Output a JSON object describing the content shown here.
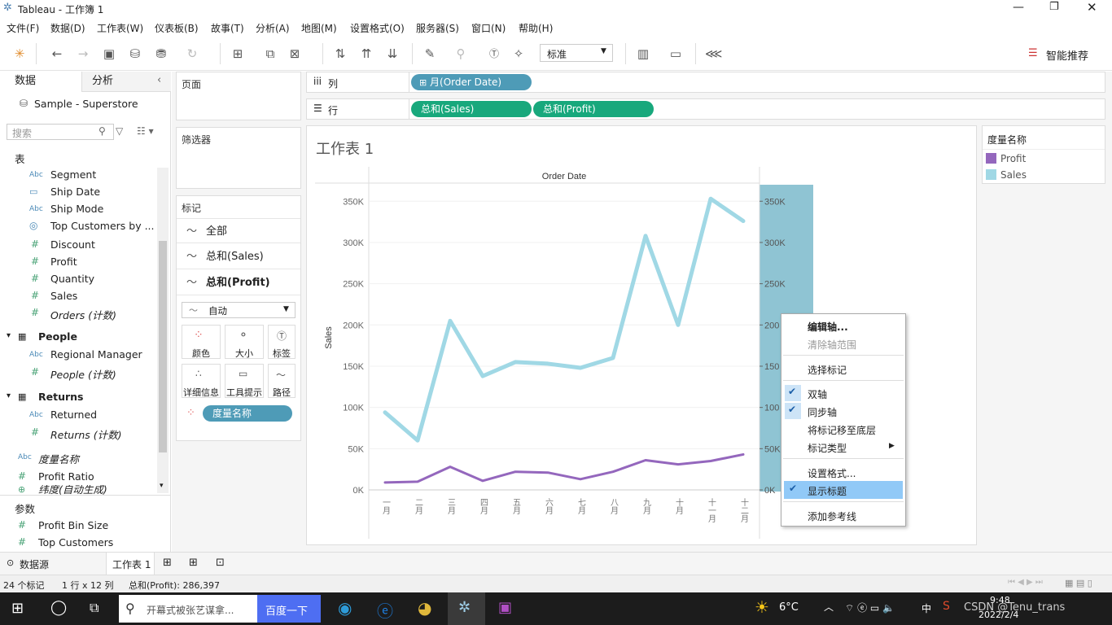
{
  "window": {
    "title": "Tableau - 工作簿 1"
  },
  "menu": [
    "文件(F)",
    "数据(D)",
    "工作表(W)",
    "仪表板(B)",
    "故事(T)",
    "分析(A)",
    "地图(M)",
    "设置格式(O)",
    "服务器(S)",
    "窗口(N)",
    "帮助(H)"
  ],
  "toolbar": {
    "fit_value": "标准",
    "recommend_label": "智能推荐"
  },
  "left": {
    "tab_data": "数据",
    "tab_analysis": "分析",
    "datasource": "Sample - Superstore",
    "search_placeholder": "搜索",
    "section_table": "表",
    "orders_fields": [
      {
        "type": "Abc",
        "name": "Segment"
      },
      {
        "type": "date",
        "name": "Ship Date"
      },
      {
        "type": "Abc",
        "name": "Ship Mode"
      },
      {
        "type": "set",
        "name": "Top Customers by ..."
      },
      {
        "type": "#",
        "name": "Discount"
      },
      {
        "type": "#",
        "name": "Profit"
      },
      {
        "type": "#",
        "name": "Quantity"
      },
      {
        "type": "#",
        "name": "Sales"
      },
      {
        "type": "#",
        "name": "Orders (计数)"
      }
    ],
    "people_title": "People",
    "people_fields": [
      {
        "type": "Abc",
        "name": "Regional Manager"
      },
      {
        "type": "#",
        "name": "People (计数)"
      }
    ],
    "returns_title": "Returns",
    "returns_fields": [
      {
        "type": "Abc",
        "name": "Returned"
      },
      {
        "type": "#",
        "name": "Returns (计数)"
      }
    ],
    "measure_names": "度量名称",
    "profit_ratio": "Profit Ratio",
    "latitude": "纬度(自动生成)",
    "section_params": "参数",
    "params": [
      "Profit Bin Size",
      "Top Customers"
    ]
  },
  "shelves": {
    "pages_label": "页面",
    "filters_label": "筛选器",
    "marks_label": "标记",
    "columns_label": "列",
    "rows_label": "行",
    "columns_pill": "月(Order Date)",
    "rows_pills": [
      "总和(Sales)",
      "总和(Profit)"
    ]
  },
  "marks": {
    "rows": [
      "全部",
      "总和(Sales)",
      "总和(Profit)"
    ],
    "type_value": "自动",
    "buttons": [
      "颜色",
      "大小",
      "标签",
      "详细信息",
      "工具提示",
      "路径"
    ],
    "color_pill": "度量名称"
  },
  "sheet": {
    "title": "工作表 1",
    "header": "Order Date"
  },
  "legend": {
    "title": "度量名称",
    "items": [
      {
        "name": "Profit",
        "color": "#9467bd"
      },
      {
        "name": "Sales",
        "color": "#a0d8e5"
      }
    ]
  },
  "chart_data": {
    "type": "line",
    "categories": [
      "一月",
      "二月",
      "三月",
      "四月",
      "五月",
      "六月",
      "七月",
      "八月",
      "九月",
      "十月",
      "十一月",
      "十二月"
    ],
    "series": [
      {
        "name": "Sales",
        "color": "#a0d8e5",
        "values": [
          94000,
          60000,
          205000,
          138000,
          155000,
          153000,
          148000,
          160000,
          308000,
          200000,
          353000,
          326000
        ]
      },
      {
        "name": "Profit",
        "color": "#9467bd",
        "values": [
          9000,
          10000,
          28000,
          11000,
          22000,
          21000,
          13000,
          22000,
          36000,
          31000,
          35000,
          43000
        ]
      }
    ],
    "ylabel": "Sales",
    "ylim": [
      0,
      370000
    ],
    "yticks": [
      {
        "v": 0,
        "label": "0K"
      },
      {
        "v": 50000,
        "label": "50K"
      },
      {
        "v": 100000,
        "label": "100K"
      },
      {
        "v": 150000,
        "label": "150K"
      },
      {
        "v": 200000,
        "label": "200K"
      },
      {
        "v": 250000,
        "label": "250K"
      },
      {
        "v": 300000,
        "label": "300K"
      },
      {
        "v": 350000,
        "label": "350K"
      }
    ],
    "right_ticks": [
      "0K",
      "50K",
      "100",
      "150",
      "200",
      "250K",
      "300K",
      "350K"
    ]
  },
  "context_menu": {
    "items": [
      {
        "label": "编辑轴...",
        "bold": true
      },
      {
        "label": "清除轴范围",
        "disabled": true
      },
      {
        "label": "选择标记"
      },
      {
        "label": "双轴",
        "checked": true
      },
      {
        "label": "同步轴",
        "checked": true
      },
      {
        "label": "将标记移至底层"
      },
      {
        "label": "标记类型",
        "submenu": "▶"
      },
      {
        "label": "设置格式..."
      },
      {
        "label": "显示标题",
        "checked": true,
        "highlighted": true
      },
      {
        "label": "添加参考线"
      }
    ]
  },
  "sheet_tabs": {
    "datasource": "数据源",
    "sheet": "工作表 1"
  },
  "status": {
    "marks": "24 个标记",
    "grid": "1 行 x 12 列",
    "sum": "总和(Profit): 286,397"
  },
  "taskbar": {
    "search": "开幕式被张艺谋拿...",
    "baidu": "百度一下",
    "weather": "6°C",
    "ime": "中",
    "time": "9:48",
    "date": "2022/2/4",
    "watermark": "CSDN @Tenu_trans"
  }
}
